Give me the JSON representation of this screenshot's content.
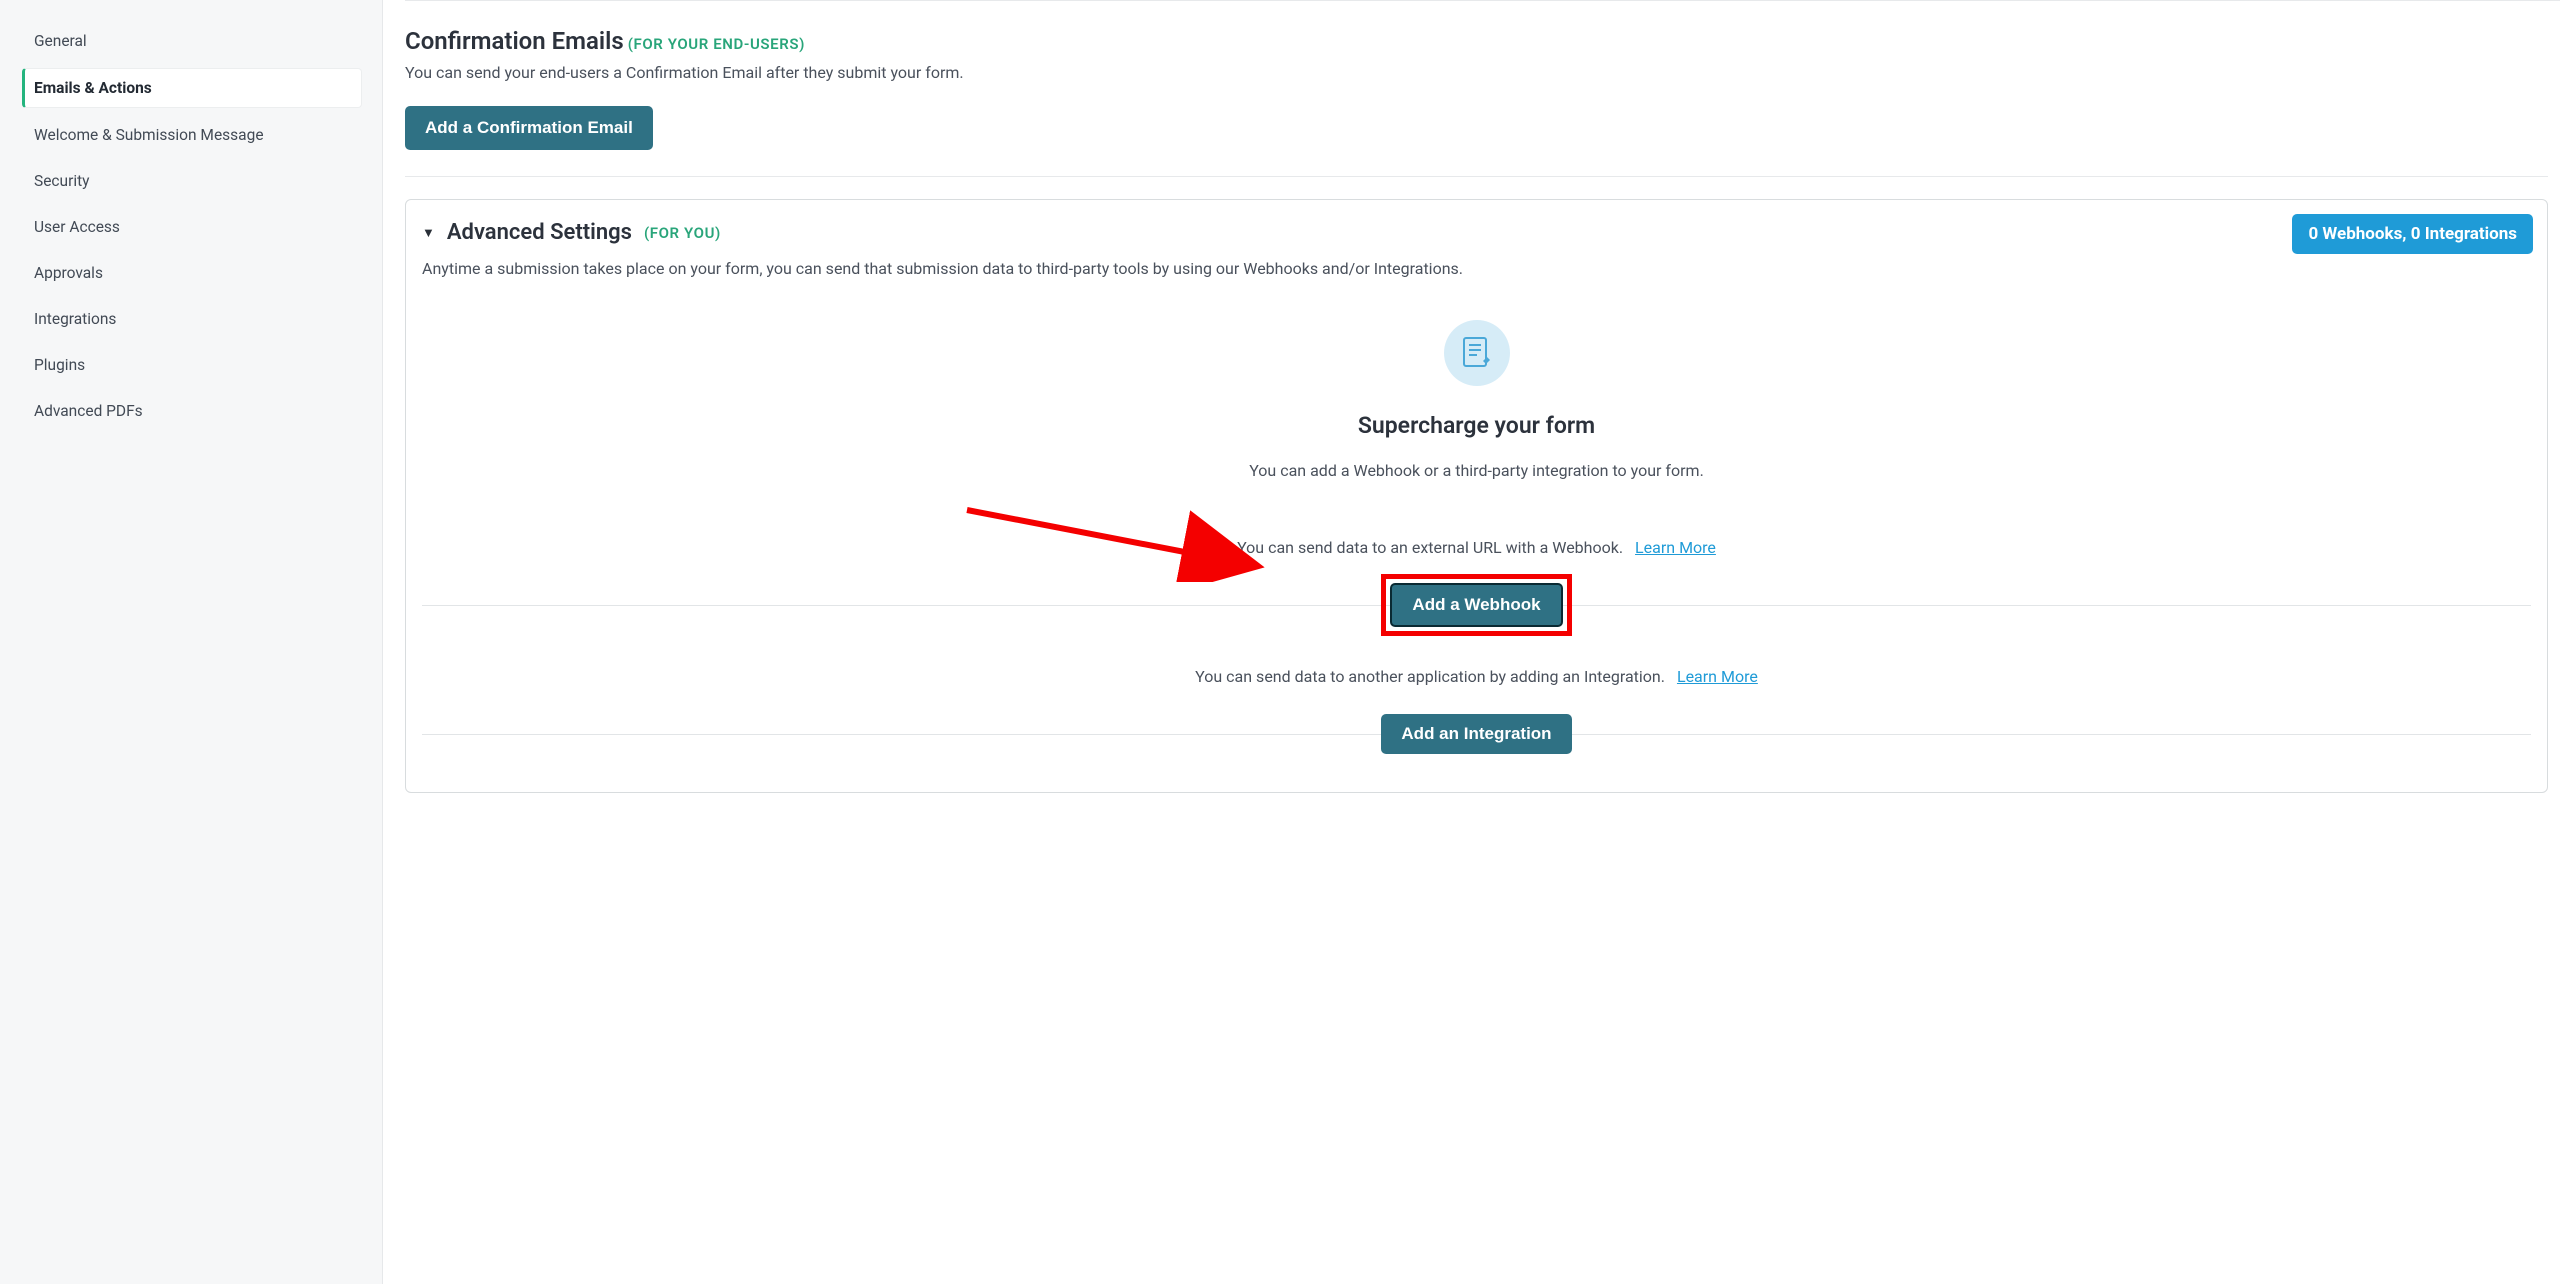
{
  "sidebar": {
    "items": [
      {
        "label": "General"
      },
      {
        "label": "Emails & Actions"
      },
      {
        "label": "Welcome & Submission Message"
      },
      {
        "label": "Security"
      },
      {
        "label": "User Access"
      },
      {
        "label": "Approvals"
      },
      {
        "label": "Integrations"
      },
      {
        "label": "Plugins"
      },
      {
        "label": "Advanced PDFs"
      }
    ]
  },
  "confirm": {
    "title": "Confirmation Emails",
    "for_tag": "(For your end-users)",
    "desc": "You can send your end-users a Confirmation Email after they submit your form.",
    "button": "Add a Confirmation Email"
  },
  "advanced": {
    "title": "Advanced Settings",
    "for_tag": "(For you)",
    "badge": "0 Webhooks, 0 Integrations",
    "desc": "Anytime a submission takes place on your form, you can send that submission data to third-party tools by using our Webhooks and/or Integrations.",
    "super_title": "Supercharge your form",
    "super_desc": "You can add a Webhook or a third-party integration to your form.",
    "webhook_text": "You can send data to an external URL with a Webhook.",
    "learn_more": "Learn More",
    "add_webhook": "Add a Webhook",
    "integration_text": "You can send data to another application by adding an Integration.",
    "add_integration": "Add an Integration"
  }
}
